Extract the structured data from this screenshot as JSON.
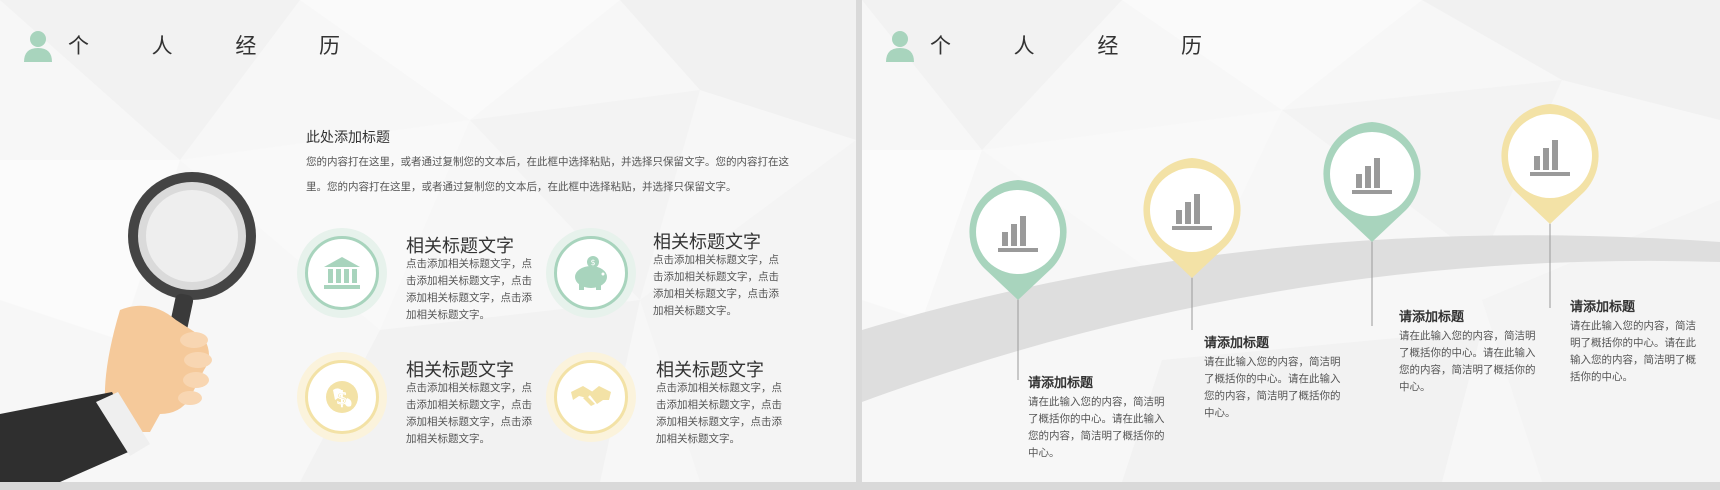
{
  "left_slide": {
    "header_title": "个 人 经 历",
    "intro": {
      "title": "此处添加标题",
      "body": "您的内容打在这里，或者通过复制您的文本后，在此框中选择粘贴，并选择只保留文字。您的内容打在这里。您的内容打在这里，或者通过复制您的文本后，在此框中选择粘贴，并选择只保留文字。"
    },
    "features": [
      {
        "title": "相关标题文字",
        "desc": "点击添加相关标题文字，点击添加相关标题文字，点击添加相关标题文字，点击添加相关标题文字。",
        "icon": "bank-icon"
      },
      {
        "title": "相关标题文字",
        "desc": "点击添加相关标题文字，点击添加相关标题文字，点击添加相关标题文字，点击添加相关标题文字。",
        "icon": "piggy-bank-icon"
      },
      {
        "title": "相关标题文字",
        "desc": "点击添加相关标题文字，点击添加相关标题文字，点击添加相关标题文字，点击添加相关标题文字。",
        "icon": "globe-dollar-icon"
      },
      {
        "title": "相关标题文字",
        "desc": "点击添加相关标题文字，点击添加相关标题文字，点击添加相关标题文字，点击添加相关标题文字。",
        "icon": "handshake-icon"
      }
    ]
  },
  "right_slide": {
    "header_title": "个 人 经 历",
    "milestones": [
      {
        "title": "请添加标题",
        "desc": "请在此输入您的内容，简洁明了概括你的中心。请在此输入您的内容，简洁明了概括你的中心。",
        "color": "#a8d4bd"
      },
      {
        "title": "请添加标题",
        "desc": "请在此输入您的内容，简洁明了概括你的中心。请在此输入您的内容，简洁明了概括你的中心。",
        "color": "#f3e2a6"
      },
      {
        "title": "请添加标题",
        "desc": "请在此输入您的内容，简洁明了概括你的中心。请在此输入您的内容，简洁明了概括你的中心。",
        "color": "#a8d4bd"
      },
      {
        "title": "请添加标题",
        "desc": "请在此输入您的内容，简洁明了概括你的中心。请在此输入您的内容，简洁明了概括你的中心。",
        "color": "#f3e2a6"
      }
    ]
  },
  "colors": {
    "green": "#a8d4bd",
    "yellow": "#f3e2a6",
    "gray": "#9a9a9a"
  }
}
